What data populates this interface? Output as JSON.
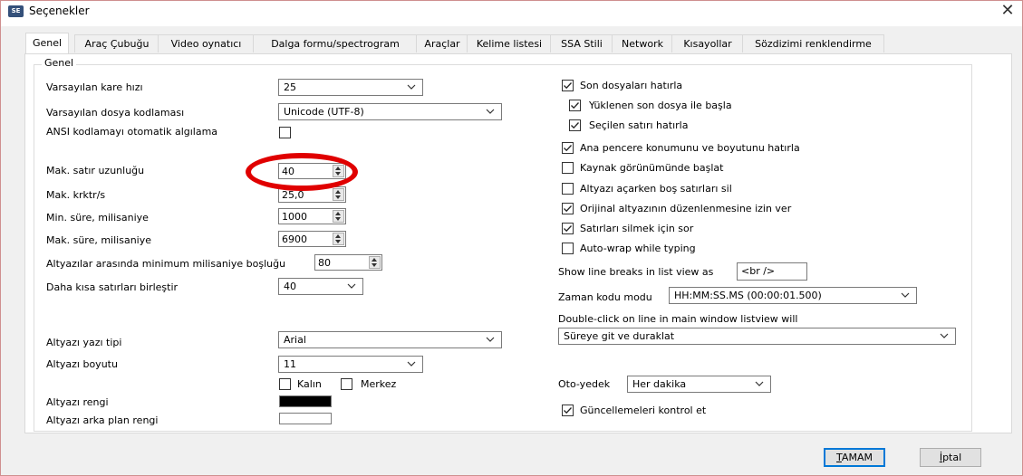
{
  "window": {
    "title": "Seçenekler",
    "app_icon_text": "SE",
    "close_glyph": "✕"
  },
  "tabs": [
    {
      "label": "Genel",
      "active": true
    },
    {
      "label": "Araç Çubuğu"
    },
    {
      "label": "Video oynatıcı"
    },
    {
      "label": "Dalga formu/spectrogram"
    },
    {
      "label": "Araçlar"
    },
    {
      "label": "Kelime listesi"
    },
    {
      "label": "SSA Stili"
    },
    {
      "label": "Network"
    },
    {
      "label": "Kısayollar"
    },
    {
      "label": "Sözdizimi renklendirme"
    }
  ],
  "group": {
    "title": "Genel"
  },
  "left": {
    "frame_rate": {
      "label": "Varsayılan kare hızı",
      "value": "25"
    },
    "encoding": {
      "label": "Varsayılan dosya kodlaması",
      "value": "Unicode (UTF-8)"
    },
    "ansi_autodetect": {
      "label": "ANSI kodlamayı otomatik algılama",
      "checked": false
    },
    "max_line_length": {
      "label": "Mak. satır uzunluğu",
      "value": "40"
    },
    "max_chars_per_sec": {
      "label": "Mak. krktr/s",
      "value": "25,0"
    },
    "min_duration": {
      "label": "Min. süre, milisaniye",
      "value": "1000"
    },
    "max_duration": {
      "label": "Mak. süre, milisaniye",
      "value": "6900"
    },
    "min_gap": {
      "label": "Altyazılar arasında minimum milisaniye boşluğu",
      "value": "80"
    },
    "merge_shorter": {
      "label": "Daha kısa satırları birleştir",
      "value": "40"
    },
    "font_name": {
      "label": "Altyazı yazı tipi",
      "value": "Arial"
    },
    "font_size": {
      "label": "Altyazı boyutu",
      "value": "11"
    },
    "bold": {
      "label": "Kalın",
      "checked": false
    },
    "center": {
      "label": "Merkez",
      "checked": false
    },
    "font_color": {
      "label": "Altyazı rengi",
      "color": "#000000"
    },
    "background_color": {
      "label": "Altyazı arka plan rengi",
      "color": "#ffffff"
    }
  },
  "right": {
    "remember_recent": {
      "label": "Son dosyaları hatırla",
      "checked": true
    },
    "start_with_last": {
      "label": "Yüklenen son dosya ile başla",
      "checked": true
    },
    "remember_selected": {
      "label": "Seçilen satırı hatırla",
      "checked": true
    },
    "remember_window": {
      "label": "Ana pencere konumunu ve boyutunu hatırla",
      "checked": true
    },
    "start_source_view": {
      "label": "Kaynak görünümünde başlat",
      "checked": false
    },
    "remove_blank_lines": {
      "label": "Altyazı açarken boş satırları sil",
      "checked": false
    },
    "allow_edit_original": {
      "label": "Orijinal altyazının düzenlenmesine izin ver",
      "checked": true
    },
    "prompt_delete_lines": {
      "label": "Satırları silmek için sor",
      "checked": true
    },
    "auto_wrap": {
      "label": "Auto-wrap while typing",
      "checked": false
    },
    "line_breaks": {
      "label": "Show line breaks in list view as",
      "value": "<br />"
    },
    "timecode_mode": {
      "label": "Zaman kodu modu",
      "value": "HH:MM:SS.MS (00:00:01.500)"
    },
    "double_click": {
      "label": "Double-click on line in main window listview will",
      "value": "Süreye git ve duraklat"
    },
    "auto_backup": {
      "label": "Oto-yedek",
      "value": "Her dakika"
    },
    "check_updates": {
      "label": "Güncellemeleri kontrol et",
      "checked": true
    }
  },
  "buttons": {
    "ok": {
      "prefix": "",
      "accel": "T",
      "rest": "AMAM"
    },
    "cancel": {
      "prefix": "",
      "accel": "İ",
      "rest": "ptal"
    }
  },
  "annotation": {
    "color": "#e00000"
  }
}
